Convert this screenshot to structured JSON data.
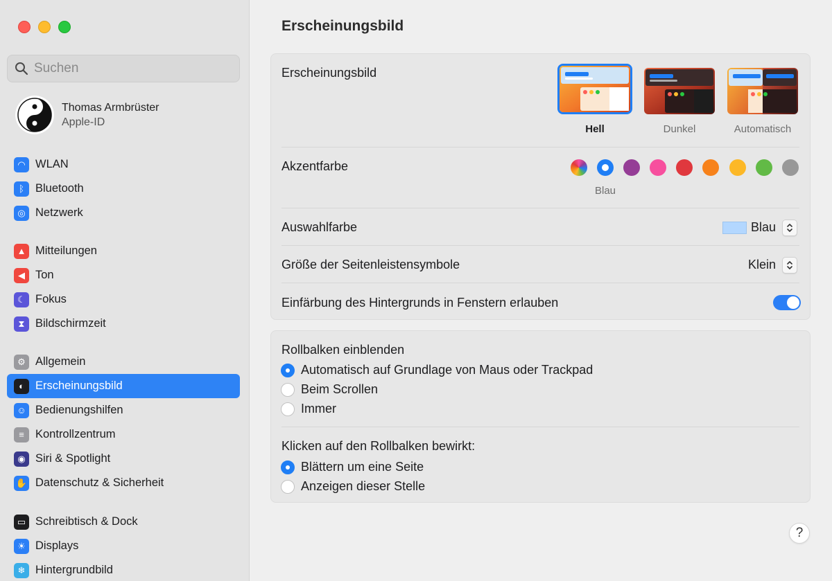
{
  "window_title": "Erscheinungsbild",
  "search": {
    "placeholder": "Suchen"
  },
  "profile": {
    "name": "Thomas Armbrüster",
    "subtitle": "Apple-ID"
  },
  "sidebar": {
    "groups": [
      [
        {
          "label": "WLAN",
          "icon": "wifi-icon",
          "color": "#2b7ff6"
        },
        {
          "label": "Bluetooth",
          "icon": "bluetooth-icon",
          "color": "#2b7ff6"
        },
        {
          "label": "Netzwerk",
          "icon": "globe-icon",
          "color": "#2b7ff6"
        }
      ],
      [
        {
          "label": "Mitteilungen",
          "icon": "bell-icon",
          "color": "#f0473e"
        },
        {
          "label": "Ton",
          "icon": "speaker-icon",
          "color": "#f0473e"
        },
        {
          "label": "Fokus",
          "icon": "moon-icon",
          "color": "#5b55d9"
        },
        {
          "label": "Bildschirmzeit",
          "icon": "hourglass-icon",
          "color": "#5b55d9"
        }
      ],
      [
        {
          "label": "Allgemein",
          "icon": "gear-icon",
          "color": "#9a9a9e"
        },
        {
          "label": "Erscheinungsbild",
          "icon": "appearance-icon",
          "color": "#1d1d1f",
          "active": true
        },
        {
          "label": "Bedienungshilfen",
          "icon": "accessibility-icon",
          "color": "#2b7ff6"
        },
        {
          "label": "Kontrollzentrum",
          "icon": "control-center-icon",
          "color": "#9a9a9e"
        },
        {
          "label": "Siri & Spotlight",
          "icon": "siri-icon",
          "color": "#3a3a8c"
        },
        {
          "label": "Datenschutz & Sicherheit",
          "icon": "hand-icon",
          "color": "#2b7ff6"
        }
      ],
      [
        {
          "label": "Schreibtisch & Dock",
          "icon": "dock-icon",
          "color": "#1d1d1f"
        },
        {
          "label": "Displays",
          "icon": "sun-icon",
          "color": "#2b7ff6"
        },
        {
          "label": "Hintergrundbild",
          "icon": "snowflake-icon",
          "color": "#3aaee8"
        }
      ]
    ]
  },
  "main": {
    "title": "Erscheinungsbild",
    "appearance": {
      "label": "Erscheinungsbild",
      "options": [
        {
          "caption": "Hell",
          "selected": true
        },
        {
          "caption": "Dunkel",
          "selected": false
        },
        {
          "caption": "Automatisch",
          "selected": false
        }
      ]
    },
    "accent": {
      "label": "Akzentfarbe",
      "selected_caption": "Blau",
      "colors": [
        "multicolor",
        "#1f7ef5",
        "#953d96",
        "#f74f9e",
        "#e0383e",
        "#f7821b",
        "#fcb827",
        "#62ba46",
        "#989898"
      ]
    },
    "highlight": {
      "label": "Auswahlfarbe",
      "value": "Blau",
      "swatch_color": "#b3d7ff"
    },
    "sidebar_icon_size": {
      "label": "Größe der Seitenleistensymbole",
      "value": "Klein"
    },
    "wallpaper_tinting": {
      "label": "Einfärbung des Hintergrunds in Fenstern erlauben",
      "enabled": true
    },
    "scrollbars": {
      "label": "Rollbalken einblenden",
      "options": [
        {
          "label": "Automatisch auf Grundlage von Maus oder Trackpad",
          "selected": true
        },
        {
          "label": "Beim Scrollen",
          "selected": false
        },
        {
          "label": "Immer",
          "selected": false
        }
      ]
    },
    "scroll_click": {
      "label": "Klicken auf den Rollbalken bewirkt:",
      "options": [
        {
          "label": "Blättern um eine Seite",
          "selected": true
        },
        {
          "label": "Anzeigen dieser Stelle",
          "selected": false
        }
      ]
    },
    "help_label": "?"
  }
}
